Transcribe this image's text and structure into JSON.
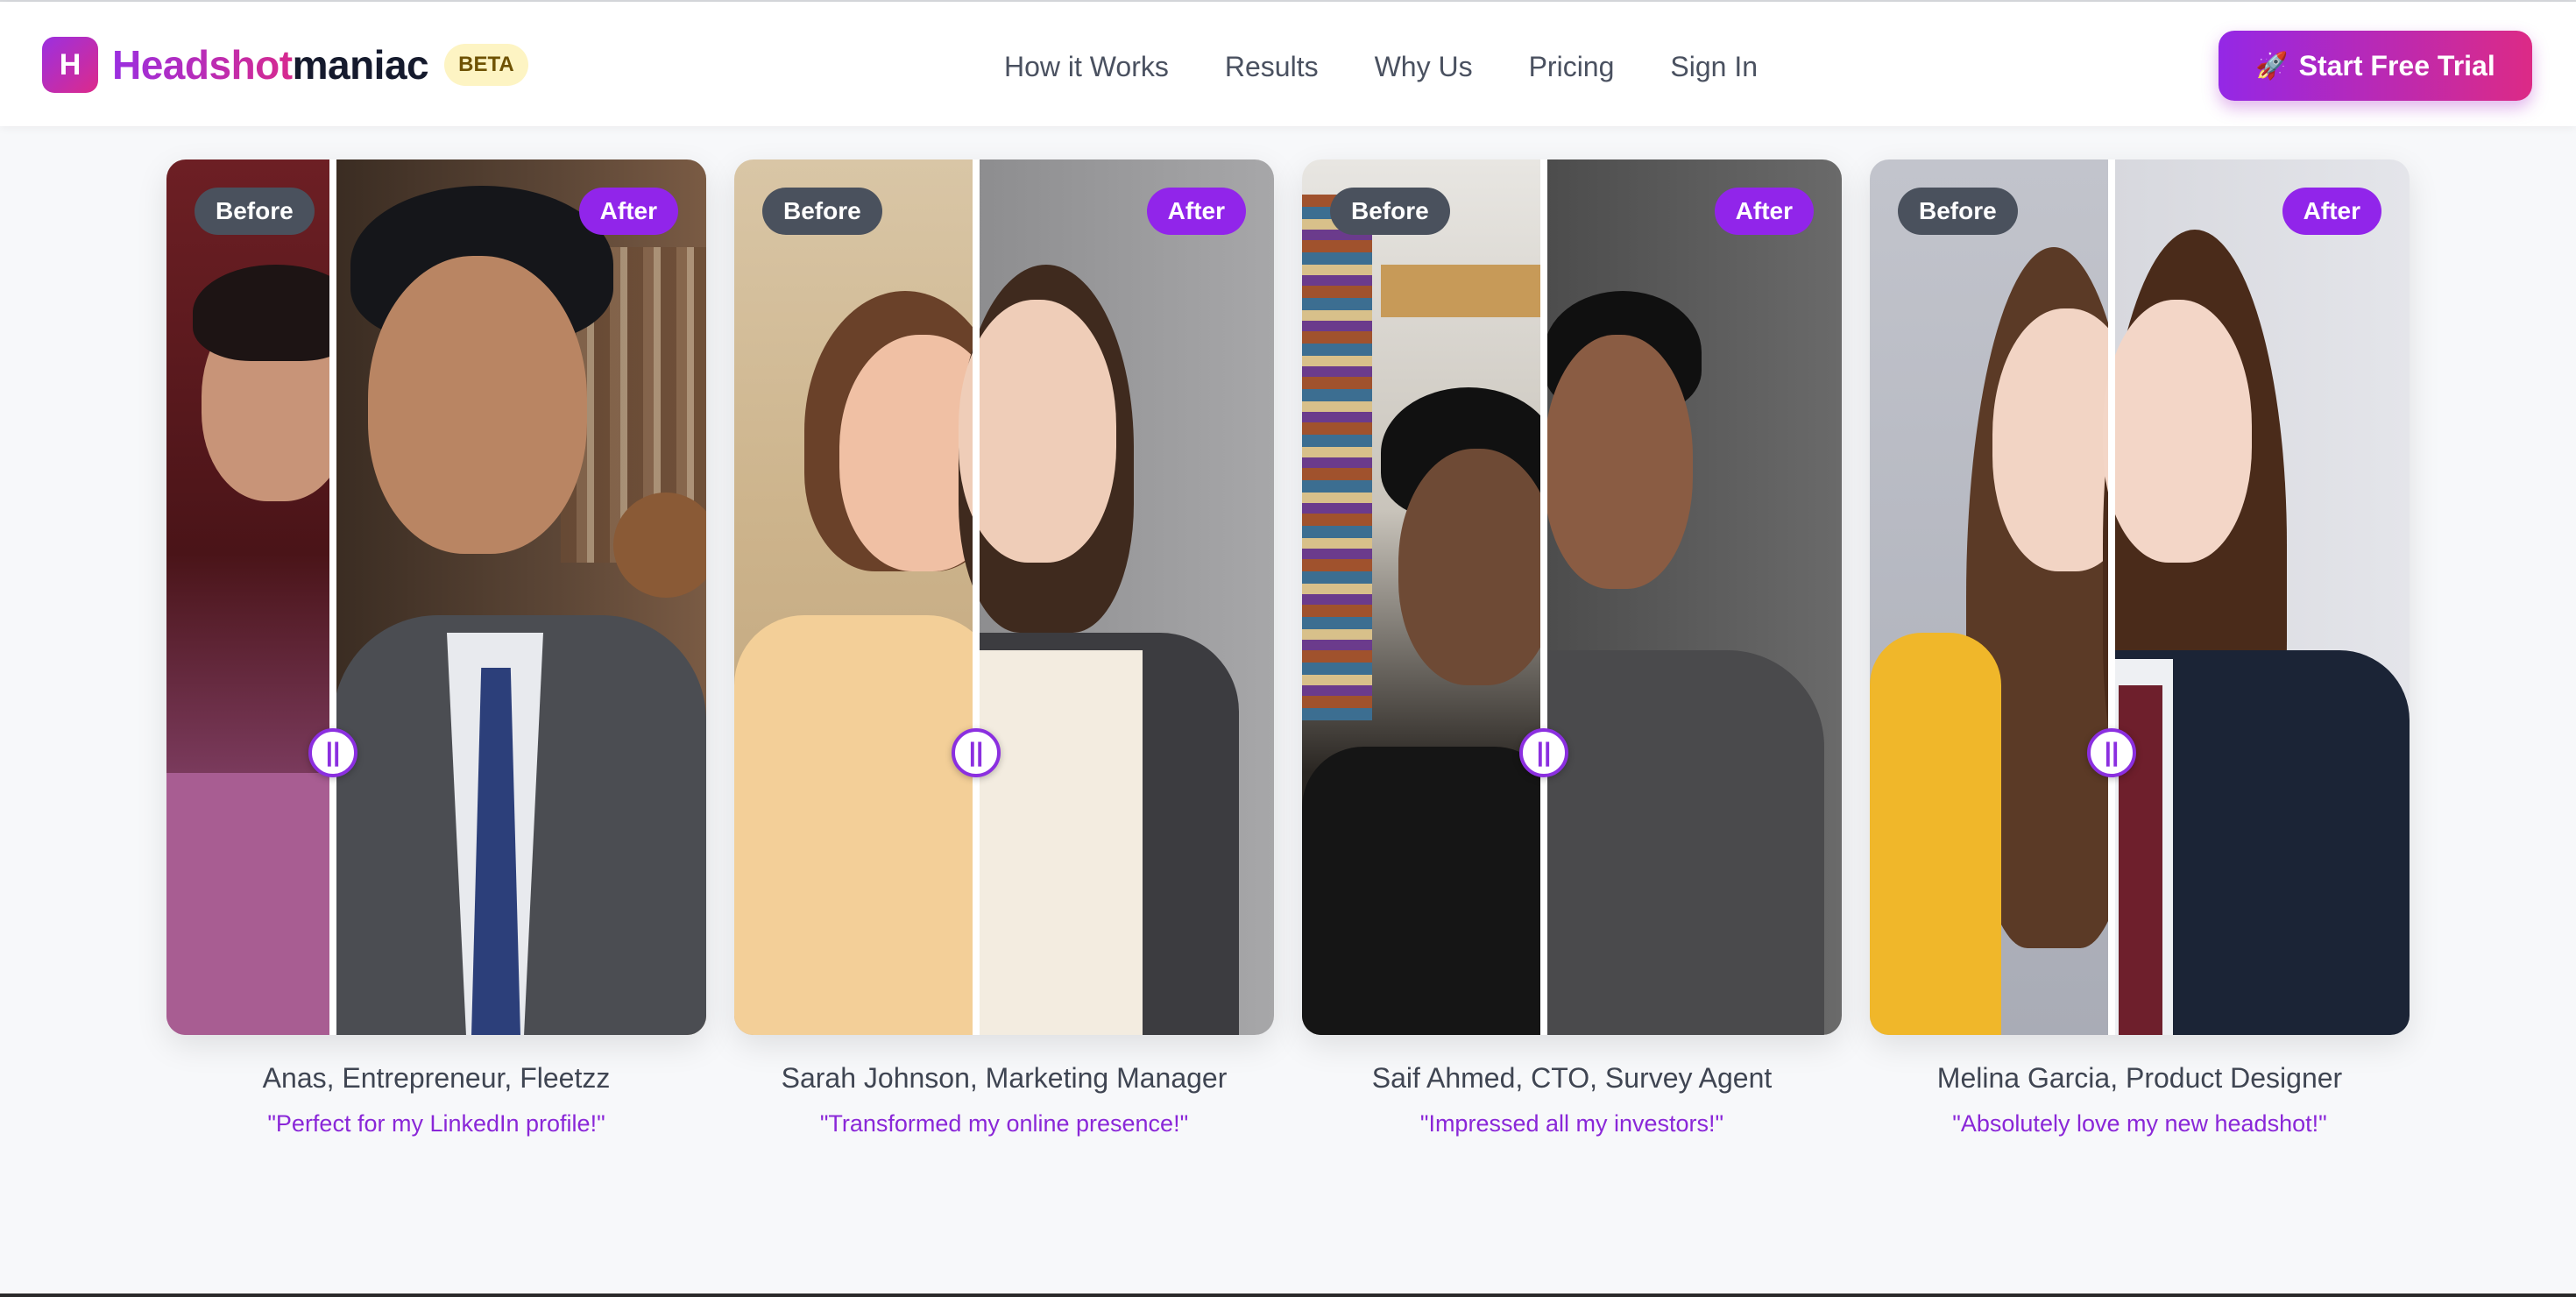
{
  "header": {
    "logo_letter": "H",
    "brand_part1": "Headshot",
    "brand_part2": "maniac",
    "beta_label": "BETA",
    "nav": [
      "How it Works",
      "Results",
      "Why Us",
      "Pricing",
      "Sign In"
    ],
    "cta_label": "Start Free Trial",
    "cta_icon": "rocket-icon"
  },
  "comparison": {
    "before_label": "Before",
    "after_label": "After",
    "handle_glyph": "||"
  },
  "cards": [
    {
      "name": "Anas, Entrepreneur, Fleetzz",
      "quote": "\"Perfect for my LinkedIn profile!\""
    },
    {
      "name": "Sarah Johnson, Marketing Manager",
      "quote": "\"Transformed my online presence!\""
    },
    {
      "name": "Saif Ahmed, CTO, Survey Agent",
      "quote": "\"Impressed all my investors!\""
    },
    {
      "name": "Melina Garcia, Product Designer",
      "quote": "\"Absolutely love my new headshot!\""
    }
  ],
  "colors": {
    "accent_purple": "#9125ea",
    "accent_pink": "#dc2a86",
    "before_badge": "#4a515d",
    "background": "#f7f8fa"
  }
}
